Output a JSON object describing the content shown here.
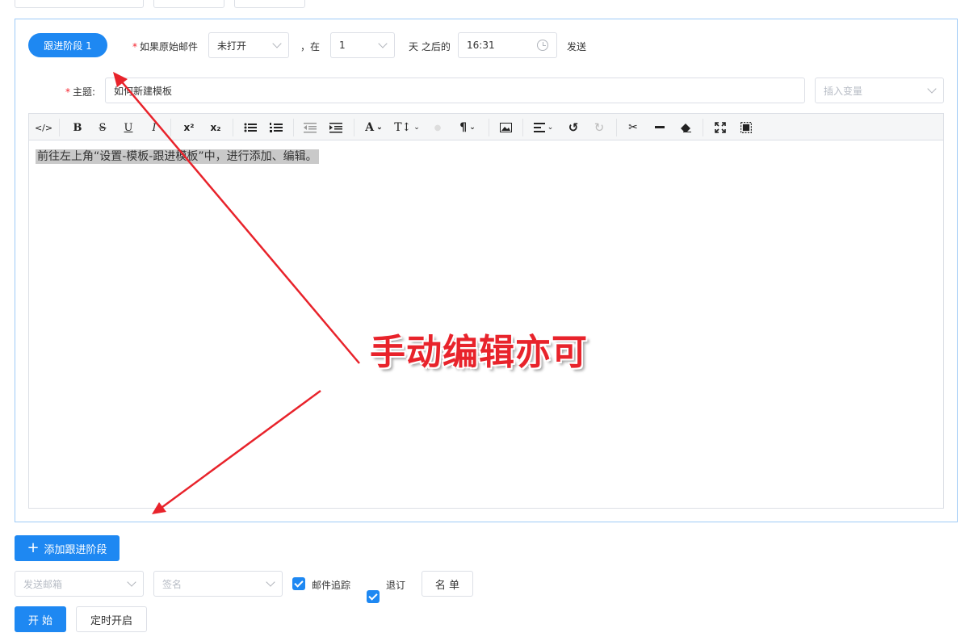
{
  "stage": {
    "pill_label": "跟进阶段 1",
    "condition_label": "如果原始邮件",
    "condition_value": "未打开",
    "in_label": "，在",
    "days_value": "1",
    "days_after_label": "天 之后的",
    "time_value": "16:31",
    "send_label": "发送",
    "subject_label": "主题:",
    "subject_value": "如何新建模板",
    "insert_var_placeholder": "插入变量"
  },
  "toolbar": {
    "items": [
      "code",
      "bold",
      "strikethrough",
      "underline",
      "italic",
      "superscript",
      "subscript",
      "bullet-list",
      "numbered-list",
      "outdent",
      "indent",
      "font-color",
      "font-size",
      "paragraph",
      "image",
      "align",
      "undo",
      "redo",
      "cut",
      "horizontal-rule",
      "eraser",
      "fullscreen",
      "select-all"
    ]
  },
  "editor": {
    "content": "前往左上角“设置-模板-跟进模板”中，进行添加、编辑。"
  },
  "annotation": {
    "text": "手动编辑亦可",
    "color": "#e8232b"
  },
  "bottom": {
    "add_stage_label": "添加跟进阶段",
    "sender_placeholder": "发送邮箱",
    "signature_placeholder": "签名",
    "track_label": "邮件追踪",
    "unsubscribe_label": "退订",
    "list_button": "名 单",
    "start_button": "开 始",
    "schedule_button": "定时开启"
  },
  "colors": {
    "primary": "#1e88f2",
    "panel_border": "#9ecbf7",
    "required": "#f5222d"
  }
}
